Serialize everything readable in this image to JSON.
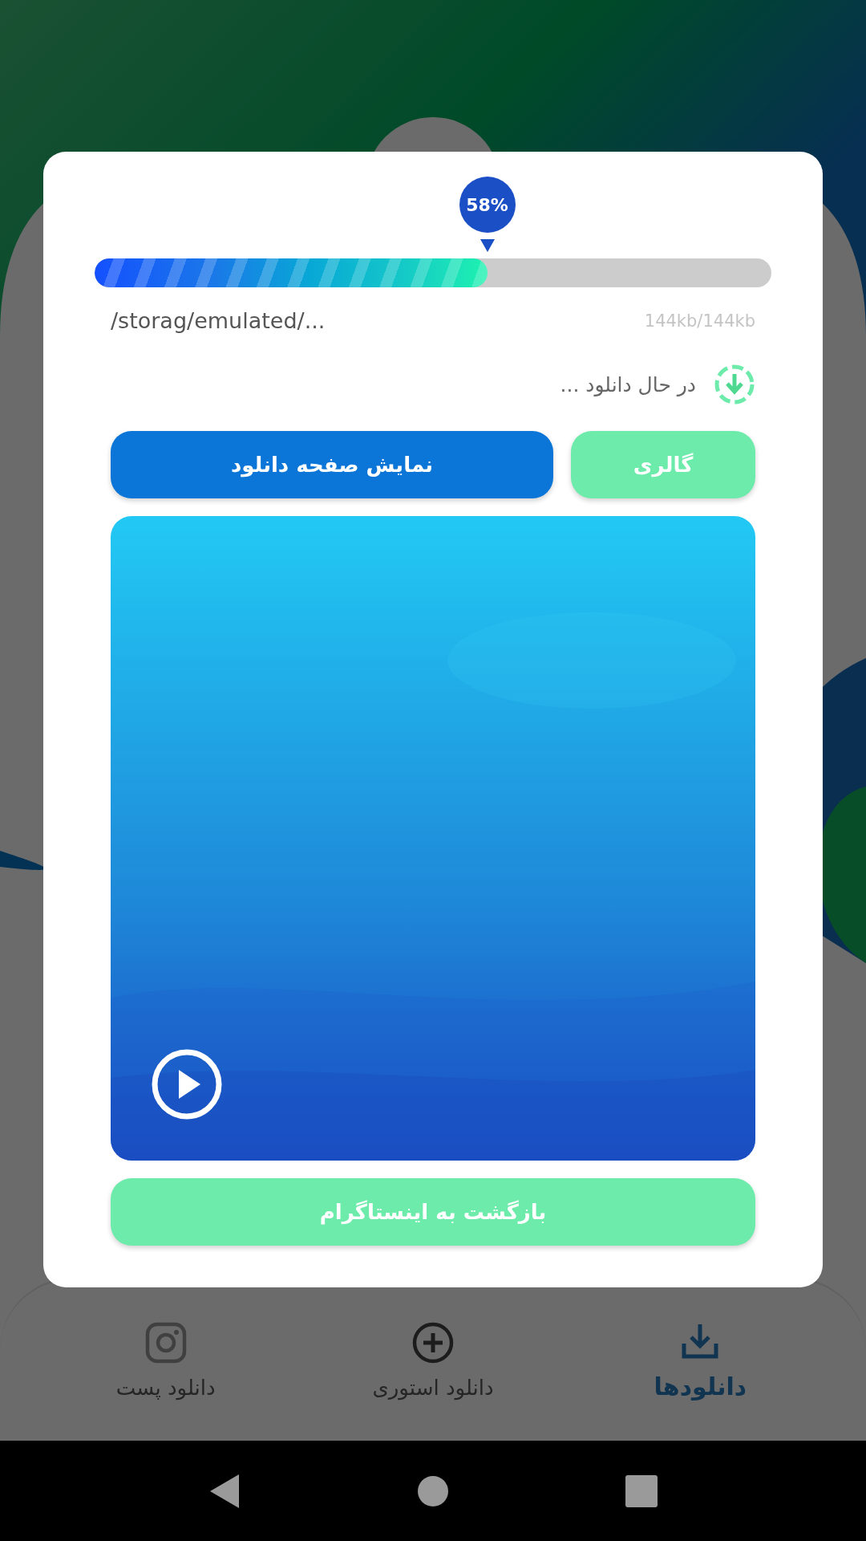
{
  "progress": {
    "level": 0.58,
    "label": "58%"
  },
  "file_path": "/storag/emulated/...",
  "size": "144kb/144kb",
  "status": "در حال دانلود ...",
  "buttons": [
    {
      "label": "گالری",
      "kind": "secondary"
    },
    {
      "label": "نمایش صفحه دانلود",
      "kind": "primary"
    }
  ],
  "back_button": "بازگشت به اینستاگرام",
  "bottom_nav": [
    {
      "label": "دانلودها",
      "selected": true
    },
    {
      "label": "دانلود استوری",
      "selected": false
    },
    {
      "label": "دانلود پست",
      "selected": false
    }
  ]
}
